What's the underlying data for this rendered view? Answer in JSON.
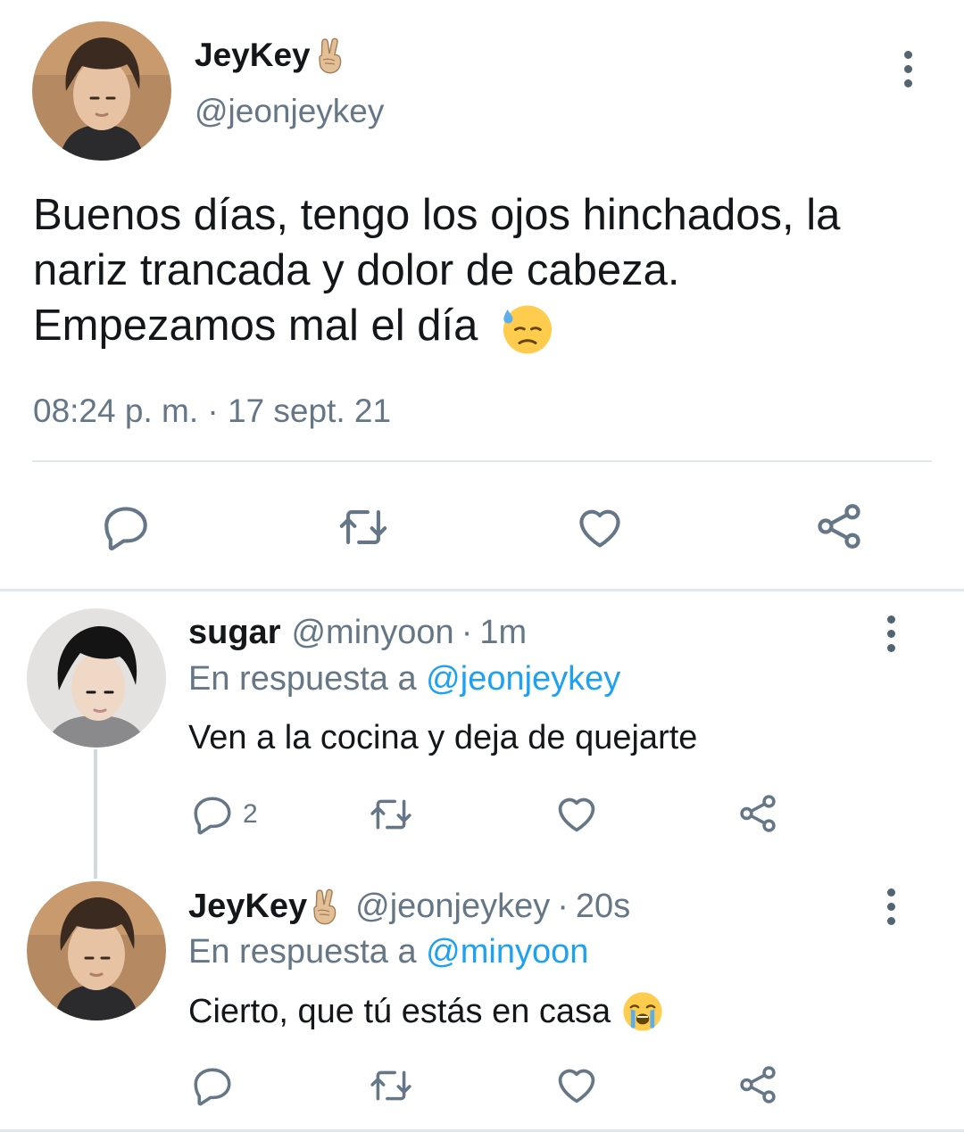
{
  "main_tweet": {
    "display_name": "JeyKey",
    "name_emoji": "victory-hand-emoji",
    "handle": "@jeonjeykey",
    "text": "Buenos días, tengo los ojos hinchados, la nariz trancada y dolor de cabeza. Empezamos mal el día",
    "text_emoji": "downcast-face-with-sweat-emoji",
    "timestamp": "08:24 p. m. · 17 sept. 21",
    "actions": [
      "reply-icon",
      "retweet-icon",
      "like-icon",
      "share-icon"
    ]
  },
  "replies": [
    {
      "display_name": "sugar",
      "handle": "@minyoon",
      "separator": "·",
      "time": "1m",
      "reply_prefix": "En respuesta a",
      "reply_to": "@jeonjeykey",
      "text": "Ven a la cocina y deja de quejarte",
      "reply_count": "2"
    },
    {
      "display_name": "JeyKey",
      "name_emoji": "victory-hand-emoji",
      "handle": "@jeonjeykey",
      "separator": "·",
      "time": "20s",
      "reply_prefix": "En respuesta a",
      "reply_to": "@minyoon",
      "text": "Cierto, que tú estás en casa",
      "text_emoji": "loudly-crying-face-emoji"
    }
  ],
  "colors": {
    "text": "#14171a",
    "secondary": "#657786",
    "link": "#1da1f2",
    "divider": "#e1e8ed"
  }
}
